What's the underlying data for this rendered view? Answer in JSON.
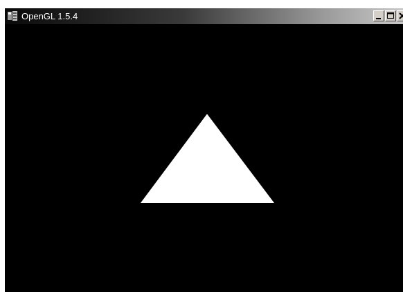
{
  "window": {
    "title": "OpenGL 1.5.4",
    "icon": "app-icon",
    "controls": {
      "minimize_icon": "minimize-icon",
      "maximize_icon": "maximize-icon",
      "close_icon": "close-icon"
    }
  },
  "scene": {
    "background_color": "#000000",
    "shape": "triangle",
    "shape_color": "#ffffff"
  }
}
